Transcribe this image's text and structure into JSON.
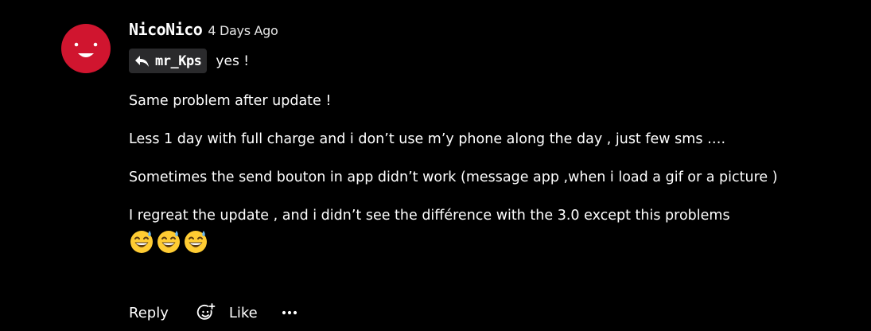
{
  "post": {
    "author": "NicoNico",
    "timestamp": "4 Days Ago",
    "avatar_color": "#d0152f",
    "quoted_user": "mr_Kps",
    "quote_icon": "reply-arrow-icon",
    "reply_text": "yes !",
    "paragraphs": [
      "Same problem after update !",
      "Less 1 day with full charge and i don’t use m’y phone along the day , just few sms ….",
      "Sometimes the send bouton in app didn’t work (message app ,when i load a gif or a picture )",
      "I regreat the update , and i didn’t see the différence with the 3.0 except this problems"
    ],
    "emojis": [
      "grinning-sweat-emoji",
      "grinning-sweat-emoji",
      "grinning-sweat-emoji"
    ]
  },
  "actions": {
    "reply_label": "Reply",
    "reaction_icon": "add-reaction-icon",
    "like_label": "Like",
    "more_icon": "more-dots-icon"
  }
}
